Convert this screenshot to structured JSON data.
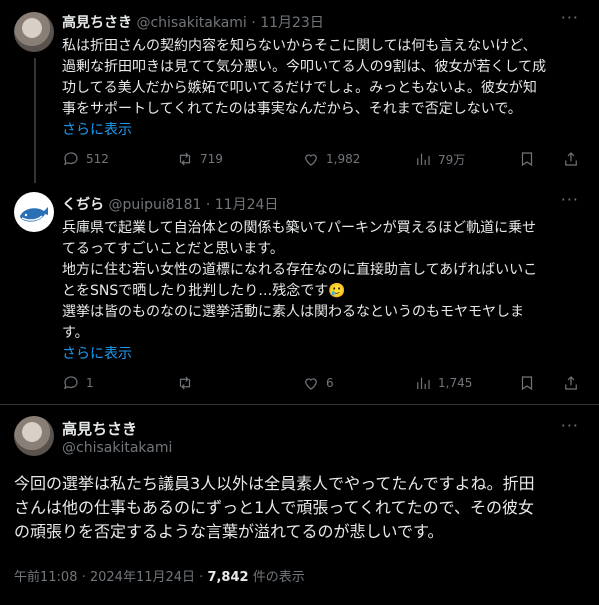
{
  "tweets": [
    {
      "name": "高見ちさき",
      "handle": "@chisakitakami",
      "date": "11月23日",
      "body_lines": [
        "私は折田さんの契約内容を知らないからそこに関しては何も言えないけど、",
        "過剰な折田叩きは見てて気分悪い。今叩いてる人の9割は、彼女が若くして成",
        "功してる美人だから嫉妬で叩いてるだけでしょ。みっともないよ。彼女が知",
        "事をサポートしてくれてたのは事実なんだから、それまで否定しないで。"
      ],
      "show_more": "さらに表示",
      "replies": "512",
      "retweets": "719",
      "likes": "1,982",
      "views": "79万"
    },
    {
      "name": "くぢら",
      "handle": "@puipui8181",
      "date": "11月24日",
      "body_lines": [
        "兵庫県で起業して自治体との関係も築いてパーキンが買えるほど軌道に乗せ",
        "てるってすごいことだと思います。",
        "地方に住む若い女性の道標になれる存在なのに直接助言してあげればいいこ",
        "とをSNSで晒したり批判したり…残念です🥲",
        "選挙は皆のものなのに選挙活動に素人は関わるなというのもモヤモヤしま",
        "す。"
      ],
      "show_more": "さらに表示",
      "replies": "1",
      "retweets": "",
      "likes": "6",
      "views": "1,745"
    }
  ],
  "main": {
    "name": "高見ちさき",
    "handle": "@chisakitakami",
    "text_lines": [
      "今回の選挙は私たち議員3人以外は全員素人でやってたんですよね。折田",
      "さんは他の仕事もあるのにずっと1人で頑張ってくれてたので、その彼女",
      "の頑張りを否定するような言葉が溢れてるのが悲しいです。"
    ],
    "timestamp": "午前11:08 · 2024年11月24日 · ",
    "view_count": "7,842",
    "view_suffix": " 件の表示"
  },
  "icons": {
    "more": "more-icon",
    "reply": "reply-icon",
    "retweet": "retweet-icon",
    "like": "like-icon",
    "views": "views-icon",
    "bookmark": "bookmark-icon",
    "share": "share-icon"
  }
}
